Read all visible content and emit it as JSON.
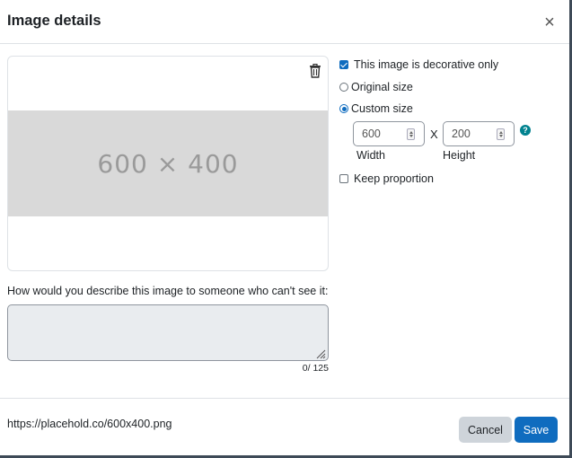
{
  "dialog": {
    "title": "Image details",
    "close_symbol": "×"
  },
  "preview": {
    "placeholder_text": "600 × 400",
    "delete_icon": "trash-icon"
  },
  "description": {
    "label": "How would you describe this image to someone who can't see it:",
    "value": "",
    "counter": "0/ 125"
  },
  "options": {
    "decorative": {
      "label": "This image is decorative only",
      "checked": true
    },
    "original_size": {
      "label": "Original size",
      "checked": false
    },
    "custom_size": {
      "label": "Custom size",
      "checked": true
    },
    "width": {
      "value": "600",
      "label": "Width"
    },
    "separator": "X",
    "height": {
      "value": "200",
      "label": "Height"
    },
    "help_symbol": "?",
    "keep_proportion": {
      "label": "Keep proportion",
      "checked": false
    }
  },
  "footer": {
    "url": "https://placehold.co/600x400.png",
    "cancel_label": "Cancel",
    "save_label": "Save"
  },
  "colors": {
    "primary": "#0f6cbf",
    "help": "#00828f",
    "secondary_button": "#ced4da"
  }
}
